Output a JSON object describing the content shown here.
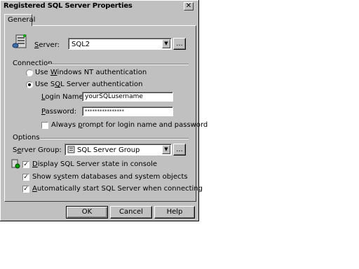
{
  "window": {
    "title": "Registered SQL Server Properties",
    "close_glyph": "✕"
  },
  "tabs": [
    {
      "label": "General"
    }
  ],
  "server": {
    "label_prefix": "",
    "label_accel": "S",
    "label_rest": "erver:",
    "value": "SQL2",
    "browse": "..."
  },
  "connection": {
    "heading": "Connection",
    "nt_auth": {
      "pre": "Use ",
      "accel": "W",
      "post": "indows NT authentication",
      "selected": false
    },
    "sql_auth": {
      "pre": "Use S",
      "accel": "Q",
      "post": "L Server authentication",
      "selected": true
    },
    "login_label": {
      "accel": "L",
      "rest": "ogin Name:"
    },
    "login_value": "yourSQLusername",
    "password_label": {
      "accel": "P",
      "rest": "assword:"
    },
    "password_value": "****************",
    "always_prompt": {
      "pre": "Always ",
      "accel": "p",
      "post": "rompt for login name and password",
      "checked": false
    }
  },
  "options": {
    "heading": "Options",
    "group_label": {
      "pre": "S",
      "accel": "e",
      "post": "rver Group:"
    },
    "group_value": "SQL Server Group",
    "browse": "...",
    "checks": [
      {
        "pre": "",
        "accel": "D",
        "post": "isplay SQL Server state in console",
        "checked": true
      },
      {
        "pre": "Show s",
        "accel": "y",
        "post": "stem databases and system objects",
        "checked": true
      },
      {
        "pre": "",
        "accel": "A",
        "post": "utomatically start SQL Server when connecting",
        "checked": true
      }
    ]
  },
  "buttons": {
    "ok": "OK",
    "cancel": "Cancel",
    "help": "Help"
  },
  "icons": {
    "server": "server-icon",
    "group": "server-group-icon",
    "state": "server-state-icon"
  },
  "colors": {
    "face": "#c0c0c0",
    "shadow": "#808080",
    "highlight": "#ffffff"
  }
}
